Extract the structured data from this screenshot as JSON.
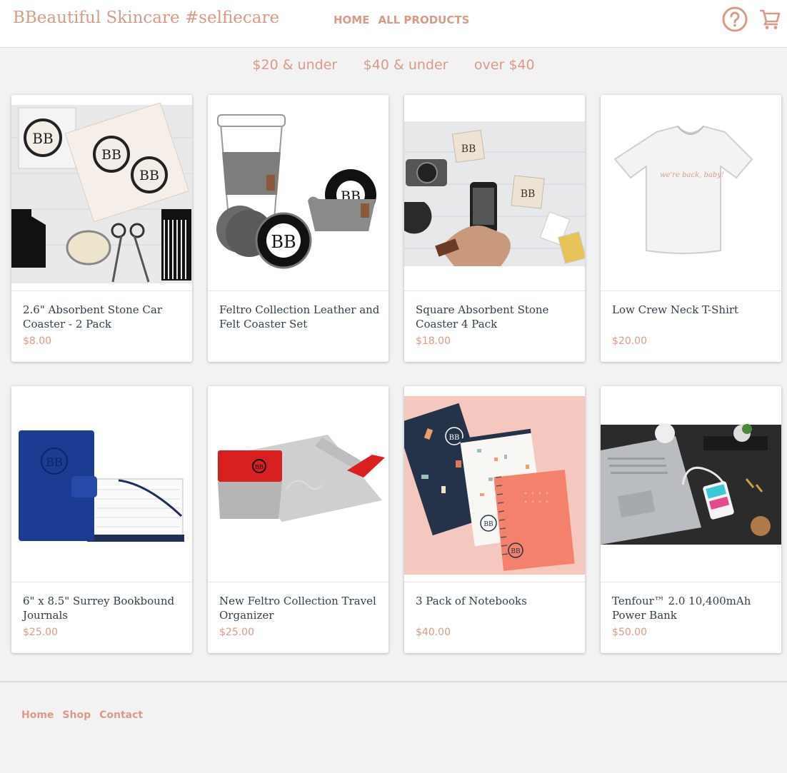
{
  "header": {
    "brand": "BBeautiful Skincare #selfiecare",
    "nav": [
      "HOME",
      "ALL PRODUCTS"
    ],
    "icons": {
      "help": "help-circle-icon",
      "cart": "shopping-cart-icon"
    }
  },
  "filters": [
    "$20 & under",
    "$40 & under",
    "over $40"
  ],
  "products": [
    {
      "title": "2.6\" Absorbent Stone Car Coaster - 2 Pack",
      "price": "$8.00"
    },
    {
      "title": "Feltro Collection Leather and Felt Coaster Set",
      "price": ""
    },
    {
      "title": "Square Absorbent Stone Coaster 4 Pack",
      "price": "$18.00"
    },
    {
      "title": "Low Crew Neck T-Shirt",
      "price": "$20.00"
    },
    {
      "title": "6\" x 8.5\" Surrey Bookbound Journals",
      "price": "$25.00"
    },
    {
      "title": "New Feltro Collection Travel Organizer",
      "price": "$25.00"
    },
    {
      "title": "3 Pack of Notebooks",
      "price": "$40.00"
    },
    {
      "title": "Tenfour™ 2.0 10,400mAh Power Bank",
      "price": "$50.00"
    }
  ],
  "footer": {
    "links": [
      "Home",
      "Shop",
      "Contact"
    ]
  },
  "colors": {
    "accent": "#d99b88",
    "background": "#f2f2f2",
    "title_text": "#33404d"
  }
}
